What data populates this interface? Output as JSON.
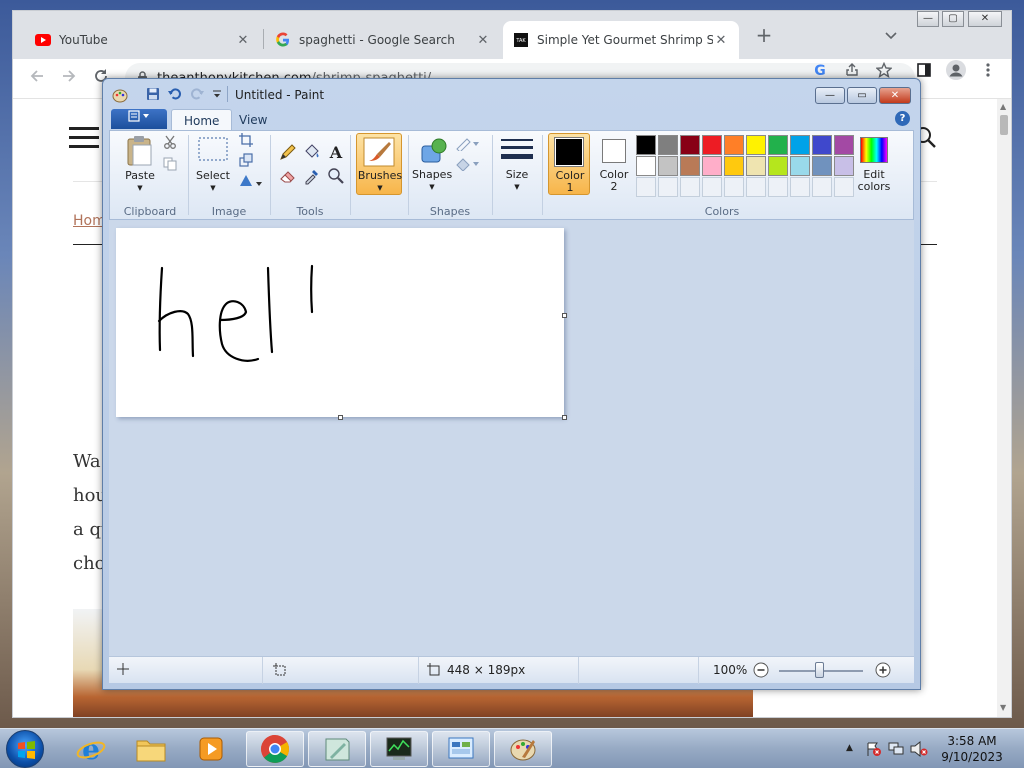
{
  "browser": {
    "tabs": [
      {
        "title": "YouTube",
        "icon": "youtube-icon",
        "active": false
      },
      {
        "title": "spaghetti - Google Search",
        "icon": "google-icon",
        "active": false
      },
      {
        "title": "Simple Yet Gourmet Shrimp Spag",
        "icon": "tak-icon",
        "active": true
      }
    ],
    "favicon_text": "TAK",
    "url_host": "theanthonykitchen.com",
    "url_path": "/shrimp-spaghetti/",
    "page": {
      "breadcrumb": "Hom",
      "text_lines": [
        "Wa",
        "hou",
        "a qu",
        "cho"
      ]
    }
  },
  "paint": {
    "title": "Untitled - Paint",
    "tabs": [
      "Home",
      "View"
    ],
    "groups": {
      "clipboard": "Clipboard",
      "image": "Image",
      "tools": "Tools",
      "shapes": "Shapes",
      "colors": "Colors"
    },
    "buttons": {
      "paste": "Paste",
      "select": "Select",
      "brushes": "Brushes",
      "shapes": "Shapes",
      "size": "Size",
      "color1_a": "Color",
      "color1_b": "1",
      "color2_a": "Color",
      "color2_b": "2",
      "edit_colors_a": "Edit",
      "edit_colors_b": "colors"
    },
    "palette_row1": [
      "#000000",
      "#7f7f7f",
      "#880015",
      "#ed1c24",
      "#ff7f27",
      "#fff200",
      "#22b14c",
      "#00a2e8",
      "#3f48cc",
      "#a349a4"
    ],
    "palette_row2": [
      "#ffffff",
      "#c3c3c3",
      "#b97a57",
      "#ffaec9",
      "#ffc90e",
      "#efe4b0",
      "#b5e61d",
      "#99d9ea",
      "#7092be",
      "#c8bfe7"
    ],
    "color1": "#000000",
    "color2": "#ffffff",
    "canvas_text": "hel",
    "status": {
      "canvas_size": "448 × 189px",
      "zoom": "100%"
    }
  },
  "taskbar": {
    "time": "3:58 AM",
    "date": "9/10/2023"
  }
}
